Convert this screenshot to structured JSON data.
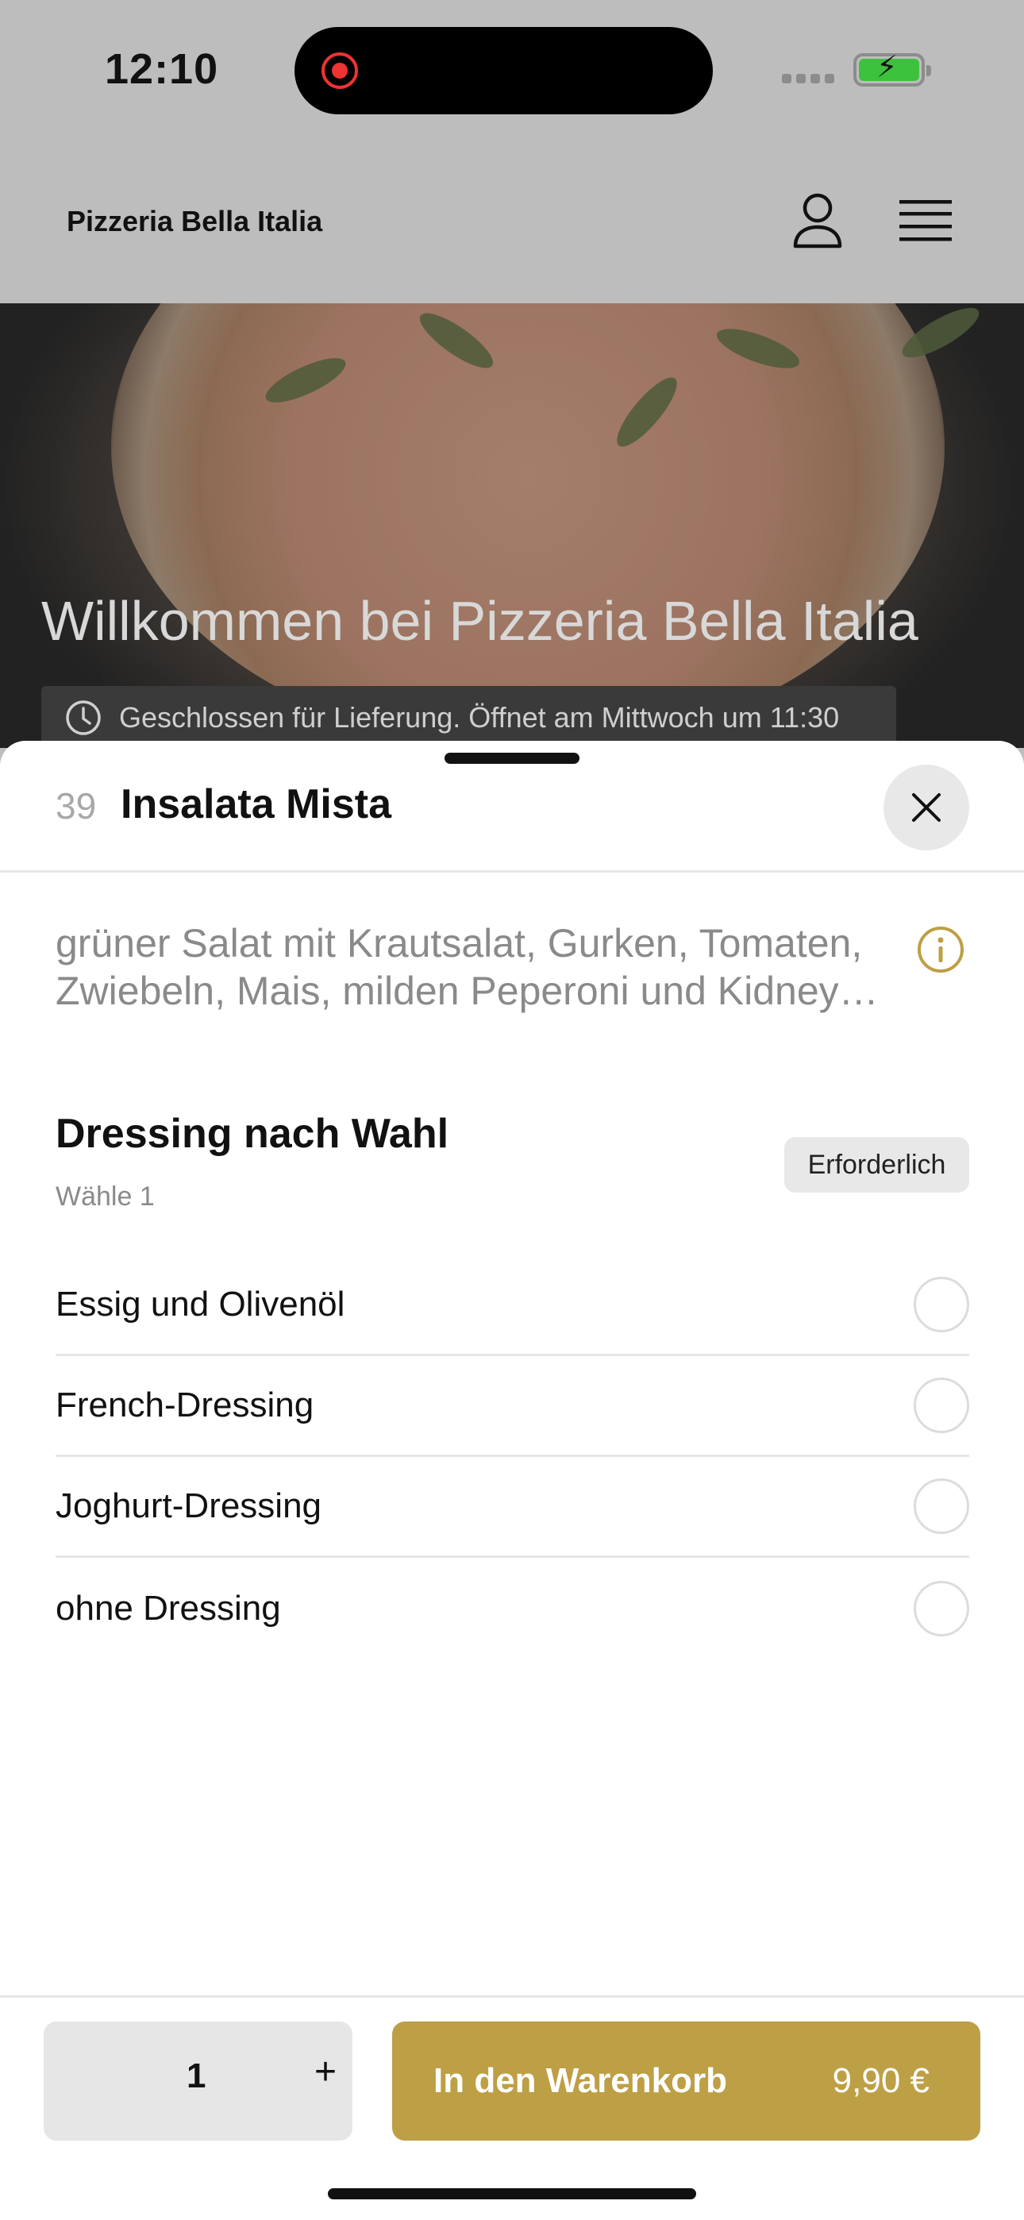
{
  "status_bar": {
    "time": "12:10"
  },
  "header": {
    "brand": "Pizzeria Bella Italia"
  },
  "hero": {
    "title": "Willkommen bei Pizzeria Bella Italia",
    "hours_notice": "Geschlossen für Lieferung. Öffnet am Mittwoch um 11:30"
  },
  "item": {
    "number": "39",
    "title": "Insalata Mista",
    "description": "grüner Salat mit Krautsalat, Gurken, Tomaten, Zwiebeln, Mais, milden Peperoni und Kidney…"
  },
  "option_group": {
    "title": "Dressing nach Wahl",
    "subtitle": "Wähle 1",
    "badge": "Erforderlich",
    "options": [
      {
        "label": "Essig und Olivenöl",
        "selected": false
      },
      {
        "label": "French-Dressing",
        "selected": false
      },
      {
        "label": "Joghurt-Dressing",
        "selected": false
      },
      {
        "label": "ohne Dressing",
        "selected": false
      }
    ]
  },
  "footer": {
    "quantity": "1",
    "plus": "+",
    "cart_label": "In den Warenkorb",
    "price": "9,90 €"
  },
  "colors": {
    "accent": "#bd9f45",
    "overlay": "#bdbdbd"
  },
  "icons": [
    "user-icon",
    "menu-icon",
    "clock-icon",
    "close-icon",
    "info-icon"
  ]
}
